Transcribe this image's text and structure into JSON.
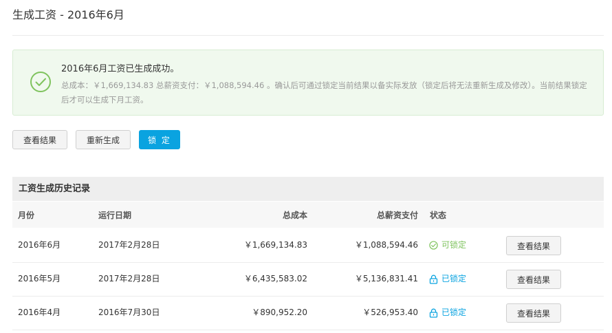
{
  "page": {
    "title": "生成工资 - 2016年6月"
  },
  "alert": {
    "heading": "2016年6月工资已生成成功。",
    "body": "总成本：￥1,669,134.83 总薪资支付：￥1,088,594.46 。确认后可通过锁定当前结果以备实际发放（锁定后将无法重新生成及修改）。当前结果锁定后才可以生成下月工资。",
    "icon": "check-circle-icon",
    "accent_color": "#7fc35e"
  },
  "actions": {
    "view_results": "查看结果",
    "regenerate": "重新生成",
    "lock": "锁 定",
    "primary_color": "#0aa3e0"
  },
  "history": {
    "title": "工资生成历史记录",
    "columns": {
      "month": "月份",
      "run_date": "运行日期",
      "total_cost": "总成本",
      "total_pay": "总薪资支付",
      "status": "状态"
    },
    "rows": [
      {
        "month": "2016年6月",
        "run_date": "2017年2月28日",
        "total_cost": "￥1,669,134.83",
        "total_pay": "￥1,088,594.46",
        "status": "可锁定",
        "status_icon": "check-circle-icon",
        "status_color": "#7fc35e",
        "action": "查看结果"
      },
      {
        "month": "2016年5月",
        "run_date": "2017年2月28日",
        "total_cost": "￥6,435,583.02",
        "total_pay": "￥5,136,831.41",
        "status": "已锁定",
        "status_icon": "lock-icon",
        "status_color": "#0aa3e0",
        "action": "查看结果"
      },
      {
        "month": "2016年4月",
        "run_date": "2016年7月30日",
        "total_cost": "￥890,952.20",
        "total_pay": "￥526,953.40",
        "status": "已锁定",
        "status_icon": "lock-icon",
        "status_color": "#0aa3e0",
        "action": "查看结果"
      }
    ]
  }
}
